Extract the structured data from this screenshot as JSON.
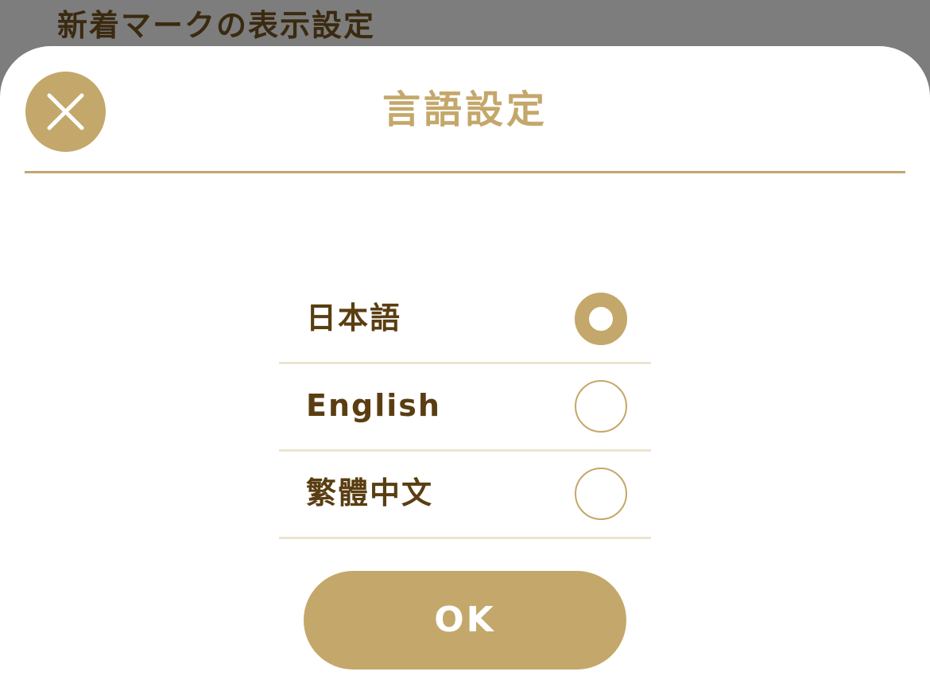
{
  "background": {
    "title": "新着マークの表示設定"
  },
  "modal": {
    "title": "言語設定",
    "close_icon": "close-icon",
    "ok_label": "OK"
  },
  "languages": [
    {
      "label": "日本語",
      "selected": true
    },
    {
      "label": "English",
      "selected": false
    },
    {
      "label": "繁體中文",
      "selected": false
    }
  ],
  "colors": {
    "accent": "#c4a76a",
    "text": "#5a3e12",
    "divider": "#ece4d2",
    "overlay": "#7d7d7d"
  }
}
